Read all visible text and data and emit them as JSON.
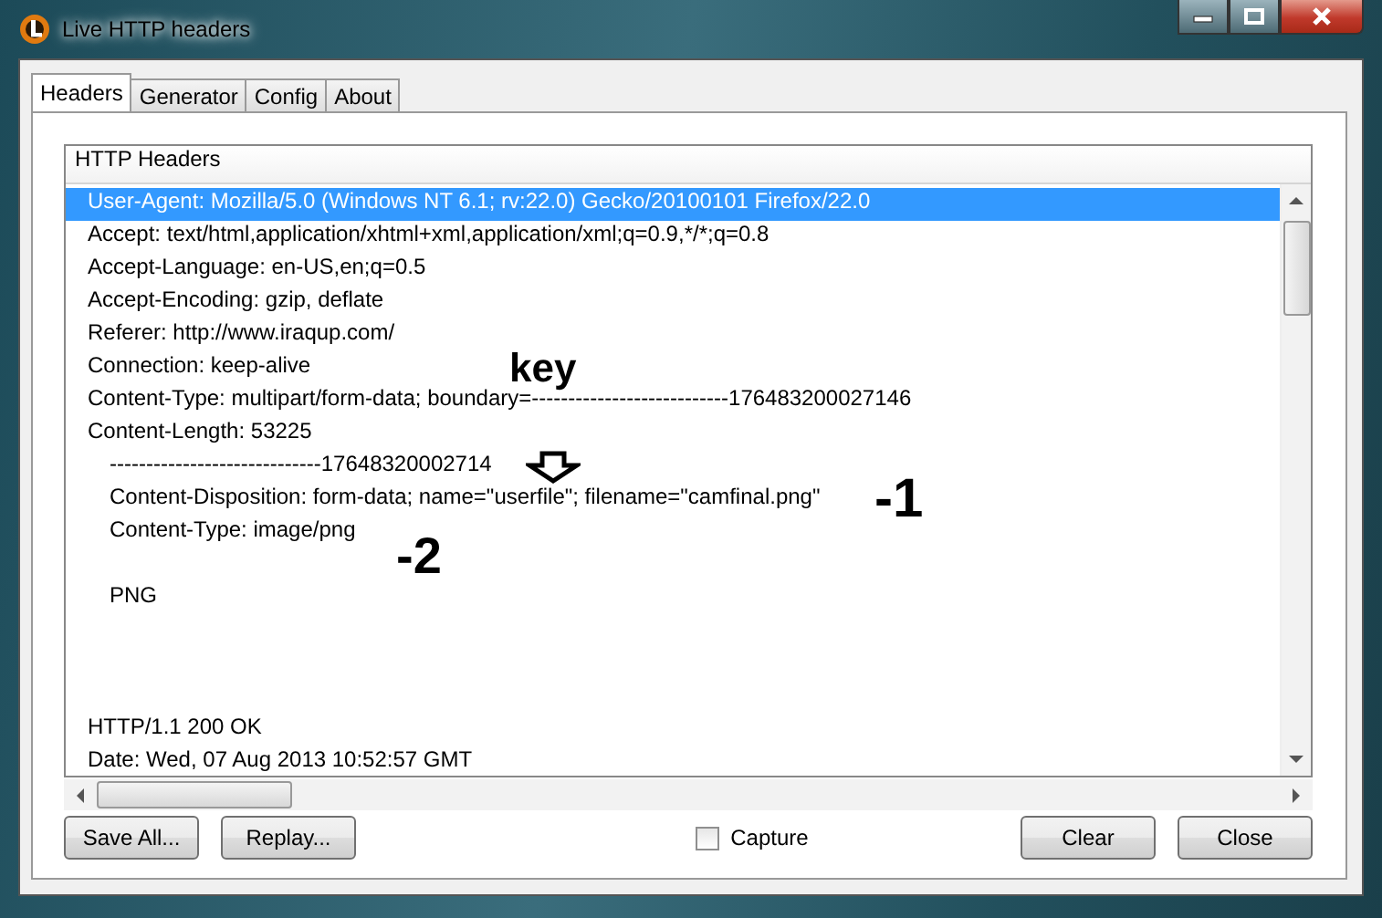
{
  "window": {
    "title": "Live HTTP headers"
  },
  "tabs": [
    {
      "label": "Headers",
      "selected": true
    },
    {
      "label": "Generator",
      "selected": false
    },
    {
      "label": "Config",
      "selected": false
    },
    {
      "label": "About",
      "selected": false
    }
  ],
  "list": {
    "header": "HTTP Headers",
    "sections": [
      {
        "lines": [
          {
            "text": "User-Agent: Mozilla/5.0 (Windows NT 6.1; rv:22.0) Gecko/20100101 Firefox/22.0",
            "selected": true
          },
          {
            "text": "Accept: text/html,application/xhtml+xml,application/xml;q=0.9,*/*;q=0.8",
            "selected": false
          },
          {
            "text": "Accept-Language: en-US,en;q=0.5",
            "selected": false
          },
          {
            "text": "Accept-Encoding: gzip, deflate",
            "selected": false
          },
          {
            "text": "Referer: http://www.iraqup.com/",
            "selected": false
          },
          {
            "text": "Connection: keep-alive",
            "selected": false
          },
          {
            "text": "Content-Type: multipart/form-data; boundary=---------------------------176483200027146",
            "selected": false
          },
          {
            "text": "Content-Length: 53225",
            "selected": false
          }
        ],
        "parts": [
          {
            "lines": [
              {
                "text": "-----------------------------17648320002714",
                "selected": false
              },
              {
                "text": "Content-Disposition: form-data; name=\"userfile\"; filename=\"camfinal.png\"",
                "selected": false
              },
              {
                "text": "Content-Type: image/png",
                "selected": false
              }
            ]
          },
          {
            "lines": [
              {
                "text": "PNG",
                "selected": false
              }
            ]
          }
        ]
      },
      {
        "lines": [
          {
            "text": "HTTP/1.1 200 OK",
            "selected": false
          },
          {
            "text": "Date: Wed, 07 Aug 2013 10:52:57 GMT",
            "selected": false
          }
        ]
      }
    ]
  },
  "annotations": [
    {
      "kind": "label",
      "text": "key"
    },
    {
      "kind": "arrow"
    },
    {
      "kind": "label",
      "text": "-1"
    },
    {
      "kind": "label",
      "text": "-2"
    }
  ],
  "buttons_left": [
    "Save All...",
    "Replay..."
  ],
  "capture": {
    "label": "Capture",
    "checked": false
  },
  "buttons_right": [
    "Clear",
    "Close"
  ]
}
